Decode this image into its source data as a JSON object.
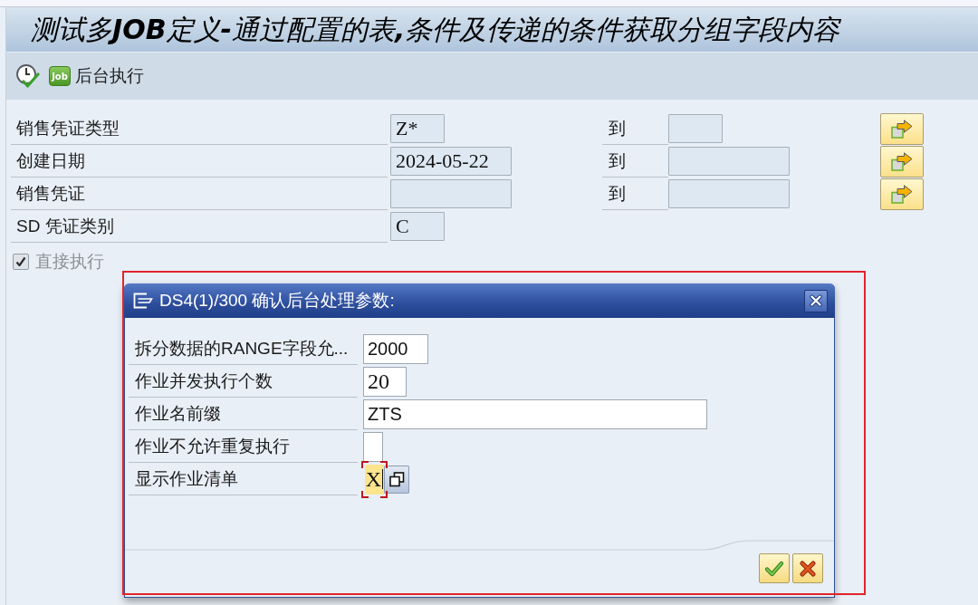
{
  "window": {
    "title": "测试多**JOB**定义**-**通过配置的表**,**条件及传递的条件获取分组字段内容"
  },
  "toolbar": {
    "job_icon_text": "Job",
    "background_execution_label": "后台执行"
  },
  "selection": {
    "rows": [
      {
        "label": "销售凭证类型",
        "kind": "code",
        "low": "Z*",
        "to_label": "到"
      },
      {
        "label": "创建日期",
        "kind": "date",
        "low": "2024-05-22",
        "to_label": "到"
      },
      {
        "label": "销售凭证",
        "kind": "document",
        "to_label": "到"
      },
      {
        "label": "SD 凭证类别",
        "kind": "code",
        "low": "C"
      }
    ],
    "direct_execution": {
      "label": "直接执行",
      "checked": true,
      "disabled": true
    }
  },
  "dialog": {
    "title": "DS4(1)/300 确认后台处理参数:",
    "fields": [
      {
        "label": "拆分数据的RANGE字段允...",
        "kind": "number",
        "value": "2000",
        "focused": false,
        "value_help": false
      },
      {
        "label": "作业并发执行个数",
        "kind": "count",
        "value": "20",
        "focused": false,
        "value_help": false
      },
      {
        "label": "作业名前缀",
        "kind": "text",
        "value": "ZTS",
        "focused": false,
        "value_help": false
      },
      {
        "label": "作业不允许重复执行",
        "kind": "flag",
        "focused": false,
        "value_help": false
      },
      {
        "label": "显示作业清单",
        "kind": "flag",
        "value": "X",
        "focused": true,
        "value_help": true
      }
    ],
    "buttons": [
      {
        "kind": "confirm"
      },
      {
        "kind": "cancel"
      }
    ]
  }
}
